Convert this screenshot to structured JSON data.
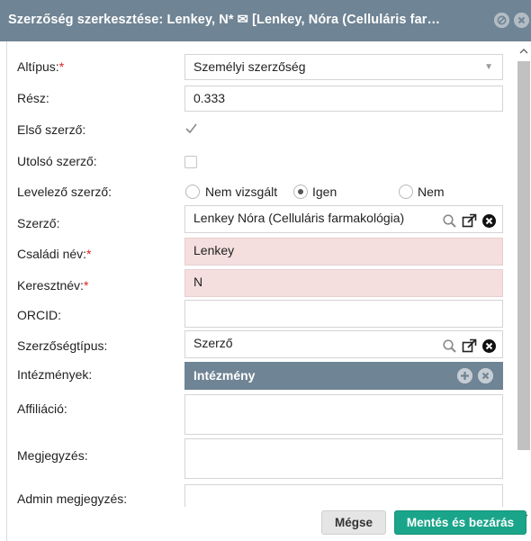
{
  "window": {
    "title": "Szerzőség szerkesztése: Lenkey, N* ✉ [Lenkey, Nóra (Celluláris far…",
    "controls": [
      "minimize-icon",
      "close-icon"
    ]
  },
  "form": {
    "altipus": {
      "label": "Altípus:",
      "required": "*",
      "value": "Személyi szerzőség"
    },
    "resz": {
      "label": "Rész:",
      "value": "0.333"
    },
    "elso_szerzo": {
      "label": "Első szerző:",
      "checked": true
    },
    "utolso_szerzo": {
      "label": "Utolsó szerző:",
      "checked": false
    },
    "levelezo_szerzo": {
      "label": "Levelező szerző:",
      "options": [
        "Nem vizsgált",
        "Igen",
        "Nem"
      ],
      "selected": "Igen"
    },
    "szerzo": {
      "label": "Szerző:",
      "value": "Lenkey Nóra (Celluláris farmakológia)"
    },
    "csaladi_nev": {
      "label": "Családi név:",
      "required": "*",
      "value": "Lenkey"
    },
    "keresztnev": {
      "label": "Keresztnév:",
      "required": "*",
      "value": "N"
    },
    "orcid": {
      "label": "ORCID:",
      "value": ""
    },
    "szerzosegtipus": {
      "label": "Szerzőségtípus:",
      "value": "Szerző"
    },
    "intezmenyek": {
      "label": "Intézmények:",
      "header": "Intézmény"
    },
    "affiliacio": {
      "label": "Affiliáció:",
      "value": ""
    },
    "megjegyzes": {
      "label": "Megjegyzés:",
      "value": ""
    },
    "admin_megjegyzes": {
      "label": "Admin megjegyzés:",
      "value": ""
    }
  },
  "footer": {
    "cancel_label": "Mégse",
    "save_label": "Mentés és bezárás"
  },
  "colors": {
    "titlebar": "#6f8494",
    "required_field_bg": "#f4dede",
    "save_button": "#1aa58a",
    "required_marker": "#e02020"
  }
}
